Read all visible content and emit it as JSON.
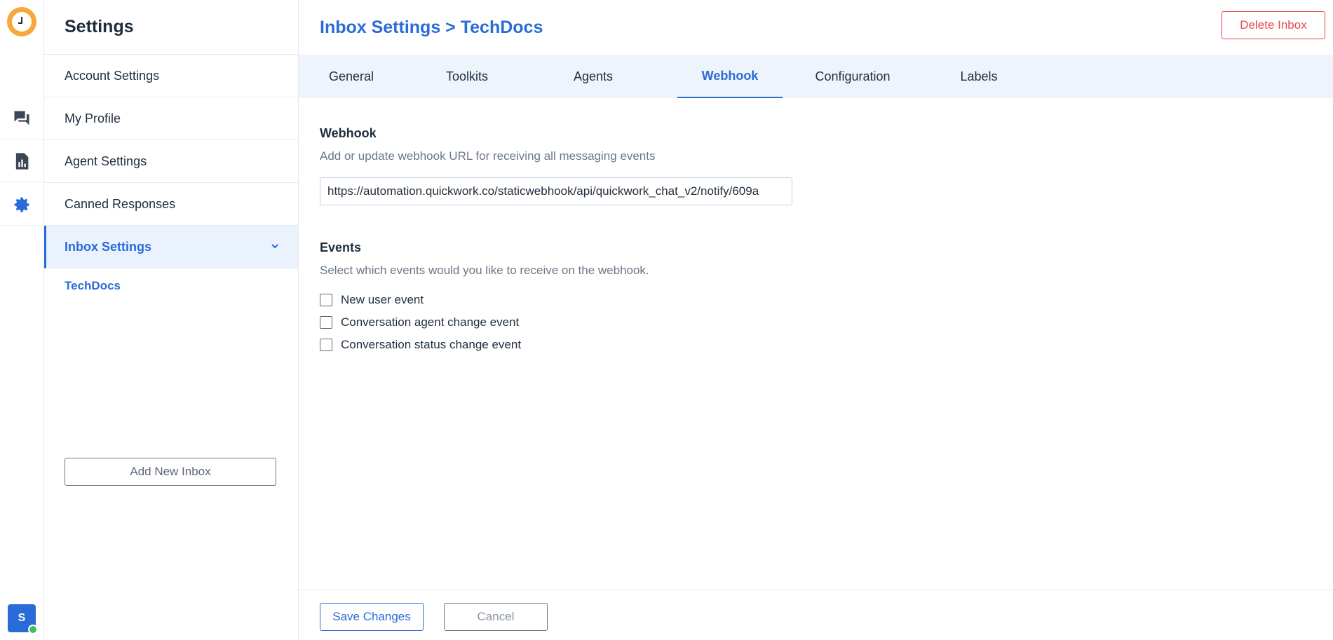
{
  "colors": {
    "accent": "#2a6bd8",
    "danger": "#e8484c",
    "logo": "#f6a83a",
    "online": "#3ec35a",
    "tabs_bg": "#eef4fc"
  },
  "rail": {
    "logo_icon": "clock-logo-icon",
    "items": [
      {
        "name": "conversations",
        "icon": "chat-bubbles-icon"
      },
      {
        "name": "reports",
        "icon": "report-icon"
      },
      {
        "name": "settings",
        "icon": "gear-icon"
      }
    ],
    "avatar_initial": "S"
  },
  "sidebar": {
    "title": "Settings",
    "items": [
      {
        "label": "Account Settings"
      },
      {
        "label": "My Profile"
      },
      {
        "label": "Agent Settings"
      },
      {
        "label": "Canned Responses"
      },
      {
        "label": "Inbox Settings"
      }
    ],
    "sub_item": "TechDocs",
    "add_button": "Add New Inbox"
  },
  "header": {
    "breadcrumb": "Inbox Settings > TechDocs",
    "delete_button": "Delete Inbox"
  },
  "tabs": [
    {
      "label": "General"
    },
    {
      "label": "Toolkits"
    },
    {
      "label": "Agents"
    },
    {
      "label": "Webhook"
    },
    {
      "label": "Configuration"
    },
    {
      "label": "Labels"
    }
  ],
  "webhook": {
    "title": "Webhook",
    "description": "Add or update webhook URL for receiving all messaging events",
    "url": "https://automation.quickwork.co/staticwebhook/api/quickwork_chat_v2/notify/609a"
  },
  "events": {
    "title": "Events",
    "description": "Select which events would you like to receive on the webhook.",
    "options": [
      {
        "label": "New user event"
      },
      {
        "label": "Conversation agent change event"
      },
      {
        "label": "Conversation status change event"
      }
    ]
  },
  "footer": {
    "save_button": "Save Changes",
    "cancel_button": "Cancel"
  }
}
